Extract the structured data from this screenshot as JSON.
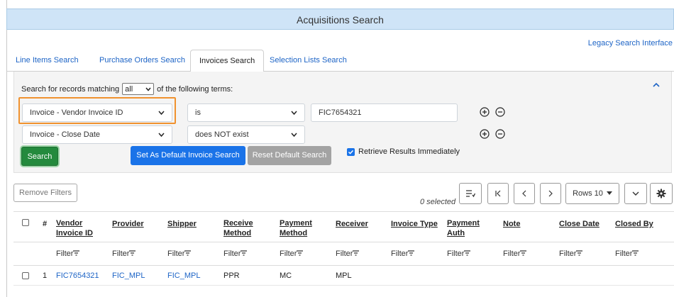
{
  "title": "Acquisitions Search",
  "legacy_link": "Legacy Search Interface",
  "tabs": [
    {
      "label": "Line Items Search",
      "active": false
    },
    {
      "label": "Purchase Orders Search",
      "active": false
    },
    {
      "label": "Invoices Search",
      "active": true
    },
    {
      "label": "Selection Lists Search",
      "active": false
    }
  ],
  "panel": {
    "prefix": "Search for records matching",
    "match_value": "all",
    "suffix": "of the following terms:"
  },
  "terms": [
    {
      "field": "Invoice - Vendor Invoice ID",
      "operator": "is",
      "value": "FIC7654321"
    },
    {
      "field": "Invoice - Close Date",
      "operator": "does NOT exist",
      "value": ""
    }
  ],
  "buttons": {
    "search": "Search",
    "set_default": "Set As Default Invoice Search",
    "reset_default": "Reset Default Search",
    "retrieve_label": "Retrieve Results Immediately",
    "remove_filters": "Remove Filters"
  },
  "grid": {
    "selected_text": "0 selected",
    "rows_label": "Rows 10",
    "headers": [
      "#",
      "Vendor Invoice ID",
      "Provider",
      "Shipper",
      "Receive Method",
      "Payment Method",
      "Receiver",
      "Invoice Type",
      "Payment Auth",
      "Note",
      "Close Date",
      "Closed By"
    ],
    "filter_label": "Filter",
    "rows": [
      {
        "num": "1",
        "vendor_invoice_id": "FIC7654321",
        "provider": "FIC_MPL",
        "shipper": "FIC_MPL",
        "receive_method": "PPR",
        "payment_method": "MC",
        "receiver": "MPL"
      }
    ]
  },
  "colors": {
    "title_bg": "#cfe4f7",
    "link": "#1d64c6",
    "search_btn": "#248a3d",
    "primary_btn": "#1a73e8",
    "disabled_btn": "#a3a3a3",
    "highlight": "#f0922f"
  }
}
